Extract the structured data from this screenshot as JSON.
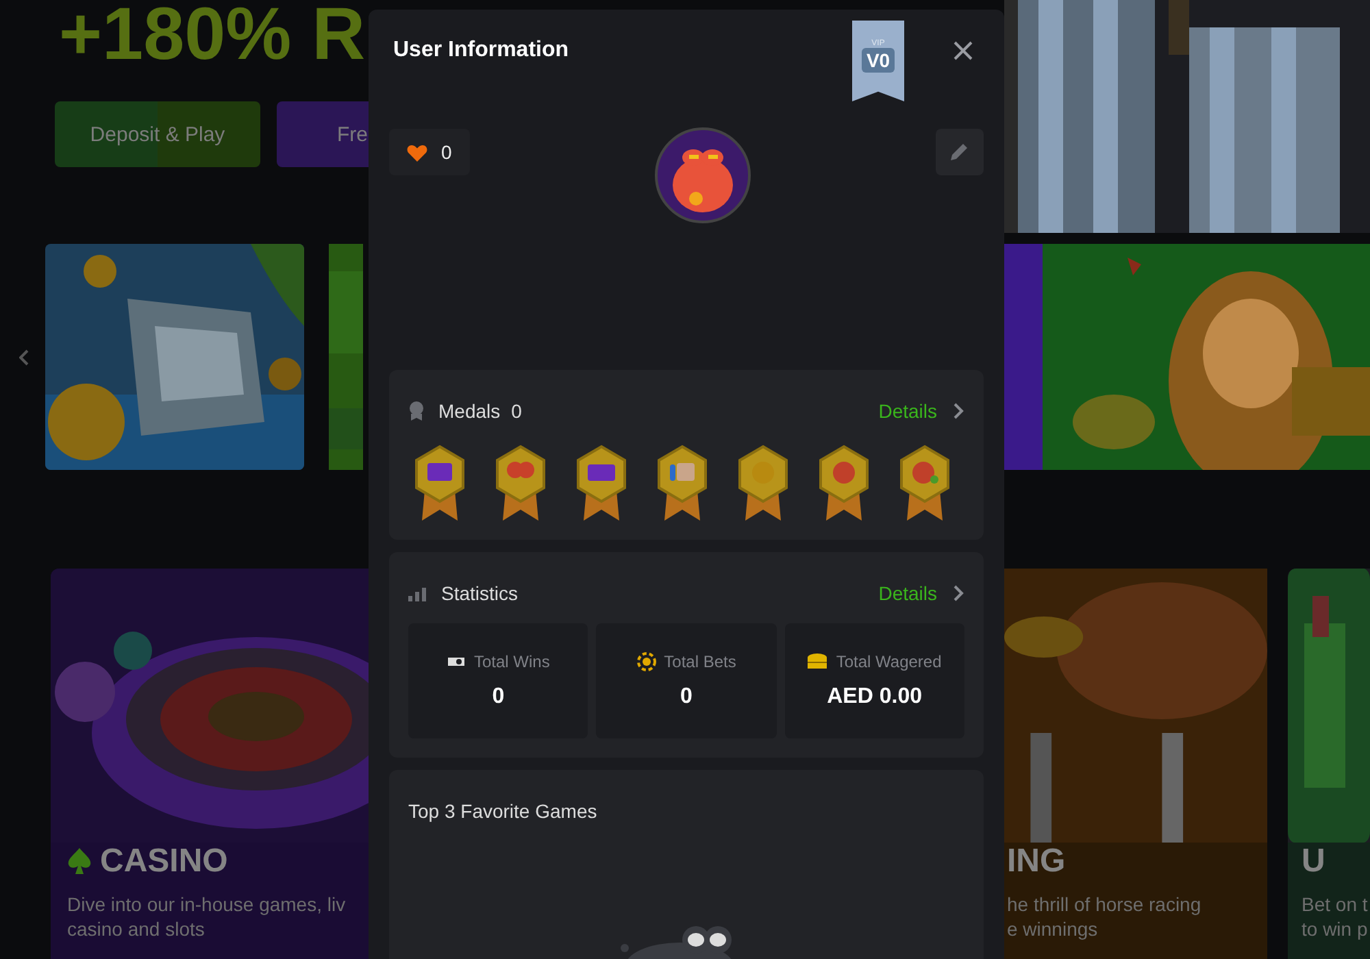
{
  "background": {
    "headline": "+180% R",
    "buttons": [
      {
        "label": "Deposit & Play",
        "kind": "deposit"
      },
      {
        "label": "Fre",
        "kind": "free"
      }
    ],
    "left_card": {
      "title": "CASINO",
      "lines": [
        "Dive into our in-house games, liv",
        "casino and slots"
      ]
    },
    "right_cards": [
      {
        "title": "ING",
        "lines": [
          "he thrill of horse racing",
          "e winnings"
        ],
        "kind": "horse"
      },
      {
        "title": "U",
        "lines": [
          "Bet on t",
          "to win p"
        ],
        "kind": "sports"
      }
    ]
  },
  "modal": {
    "title": "User Information",
    "vip_badge": {
      "caption": "VIP",
      "tier": "V0"
    },
    "likes": "0",
    "medals": {
      "title": "Medals",
      "count": "0",
      "link": "Details",
      "items": [
        {
          "kind": "message"
        },
        {
          "kind": "heart"
        },
        {
          "kind": "wallet"
        },
        {
          "kind": "thumb"
        },
        {
          "kind": "medal"
        },
        {
          "kind": "dragon"
        },
        {
          "kind": "hand"
        }
      ]
    },
    "statistics": {
      "title": "Statistics",
      "link": "Details",
      "tiles": [
        {
          "label": "Total Wins",
          "value": "0",
          "kind": "wins"
        },
        {
          "label": "Total Bets",
          "value": "0",
          "kind": "bets"
        },
        {
          "label": "Total Wagered",
          "value": "AED 0.00",
          "kind": "wagered"
        }
      ]
    },
    "favorites": {
      "title": "Top 3 Favorite Games"
    }
  }
}
